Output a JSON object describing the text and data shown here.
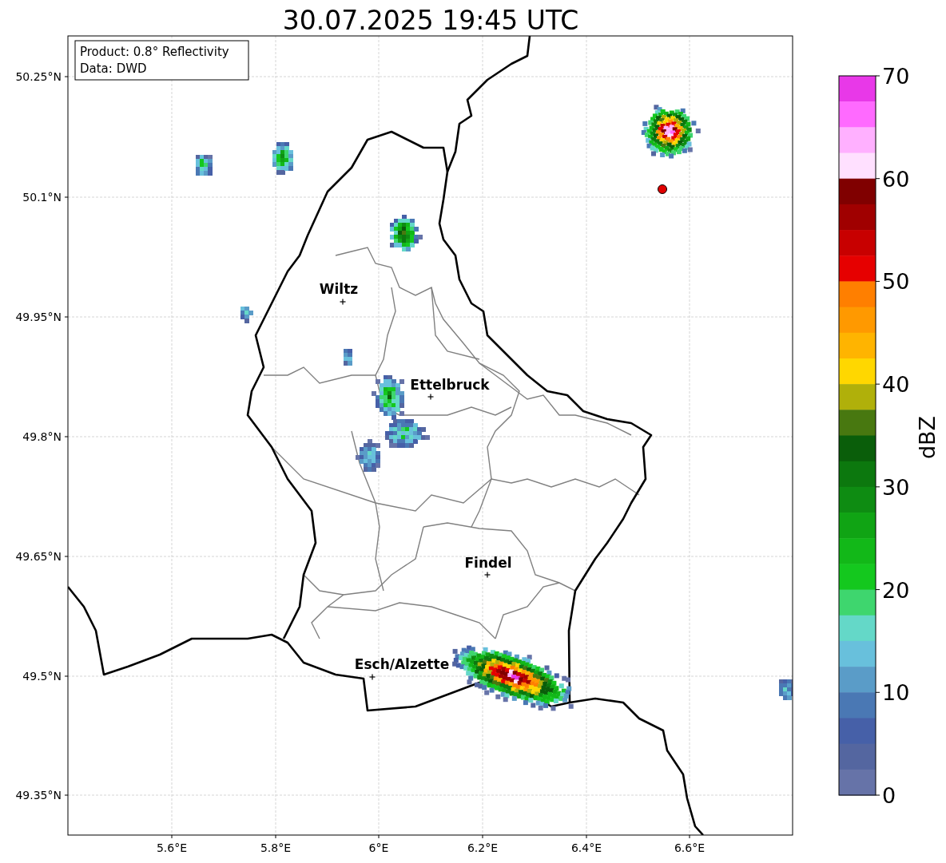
{
  "title": "30.07.2025 19:45 UTC",
  "info_box": [
    "Product: 0.8° Reflectivity",
    "Data: DWD"
  ],
  "map": {
    "lat_labels": [
      "50.25°N",
      "50.1°N",
      "49.95°N",
      "49.8°N",
      "49.65°N",
      "49.5°N",
      "49.35°N"
    ],
    "lon_labels": [
      "5.6°E",
      "5.8°E",
      "6°E",
      "6.2°E",
      "6.4°E",
      "6.6°E"
    ],
    "cities": [
      {
        "name": "Wiltz"
      },
      {
        "name": "Ettelbruck"
      },
      {
        "name": "Findel"
      },
      {
        "name": "Esch/Alzette"
      }
    ]
  },
  "colorbar": {
    "label": "dBZ",
    "ticks": [
      "70",
      "60",
      "50",
      "40",
      "30",
      "20",
      "10",
      "0"
    ],
    "segments": [
      {
        "color": "#e838e8"
      },
      {
        "color": "#ff6aff"
      },
      {
        "color": "#ffb0ff"
      },
      {
        "color": "#ffe0ff"
      },
      {
        "color": "#800000"
      },
      {
        "color": "#a00000"
      },
      {
        "color": "#c80000"
      },
      {
        "color": "#e60000"
      },
      {
        "color": "#ff7f00"
      },
      {
        "color": "#ff9900"
      },
      {
        "color": "#ffb400"
      },
      {
        "color": "#ffd700"
      },
      {
        "color": "#b0b00a"
      },
      {
        "color": "#487810"
      },
      {
        "color": "#0a5e0a"
      },
      {
        "color": "#0c780e"
      },
      {
        "color": "#0e8c12"
      },
      {
        "color": "#10a414"
      },
      {
        "color": "#12b818"
      },
      {
        "color": "#14c81e"
      },
      {
        "color": "#3ed66e"
      },
      {
        "color": "#64d8c8"
      },
      {
        "color": "#68c0dc"
      },
      {
        "color": "#5a9cc8"
      },
      {
        "color": "#4a78b4"
      },
      {
        "color": "#4660a8"
      },
      {
        "color": "#5466a0"
      },
      {
        "color": "#6673a8"
      }
    ]
  }
}
